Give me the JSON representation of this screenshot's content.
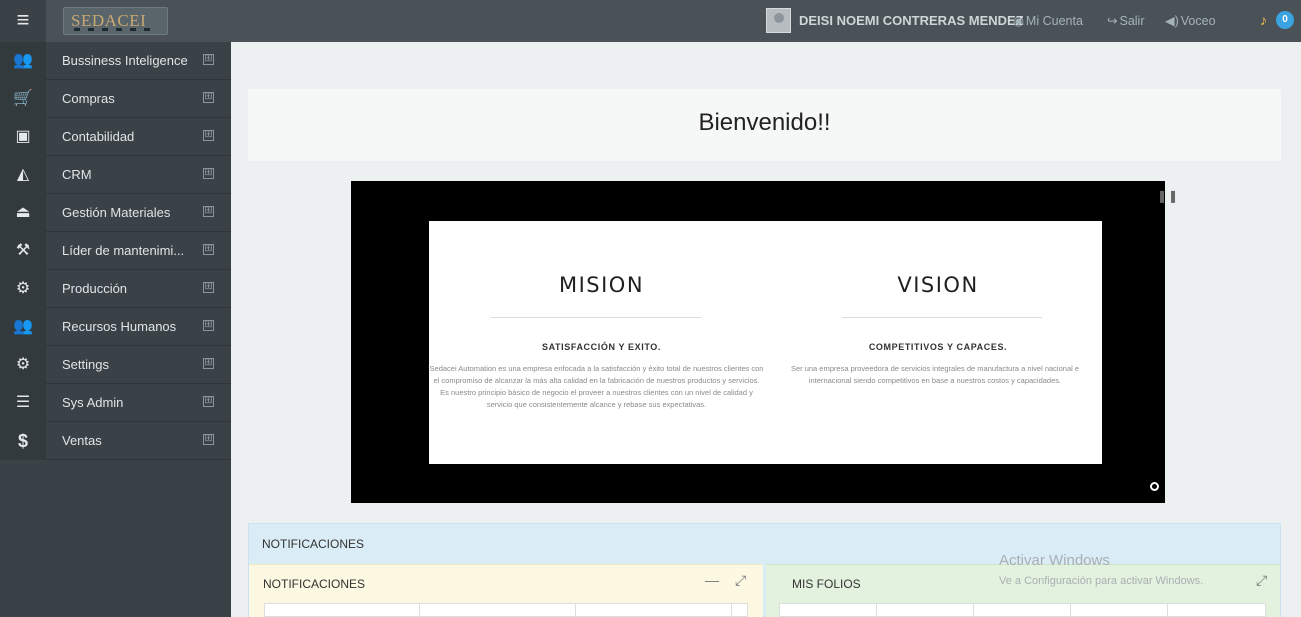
{
  "header": {
    "menu_icon": "hamburger-menu-icon",
    "logo_text": "SEDACEI",
    "user_name": "DEISI NOEMI CONTRERAS MENDEZ",
    "links": {
      "account": "Mi Cuenta",
      "logout": "Salir",
      "voice": "Voceo"
    },
    "notification_count": "0"
  },
  "sidebar": {
    "items": [
      {
        "label": "Bussiness Inteligence",
        "icon": "users-icon"
      },
      {
        "label": "Compras",
        "icon": "cart-icon"
      },
      {
        "label": "Contabilidad",
        "icon": "money-icon"
      },
      {
        "label": "CRM",
        "icon": "area-chart-icon"
      },
      {
        "label": "Gestión Materiales",
        "icon": "inbox-icon"
      },
      {
        "label": "Líder de mantenimi...",
        "icon": "wrench-icon"
      },
      {
        "label": "Producción",
        "icon": "gear-icon"
      },
      {
        "label": "Recursos Humanos",
        "icon": "users-icon"
      },
      {
        "label": "Settings",
        "icon": "gears-icon"
      },
      {
        "label": "Sys Admin",
        "icon": "server-icon"
      },
      {
        "label": "Ventas",
        "icon": "dollar-icon"
      }
    ],
    "expand_symbol": "⊞"
  },
  "main": {
    "welcome": "Bienvenido!!",
    "slide": {
      "mission": {
        "title": "MISION",
        "subtitle": "SATISFACCIÓN Y EXITO.",
        "body": "Sedacei Automation es una empresa enfocada a la satisfacción y éxito total de nuestros clientes con el compromiso de alcanzar la más alta calidad en la fabricación de nuestros productos y servicios. Es nuestro principio básico de negocio el proveer a nuestros clientes con un nivel de calidad y servicio que consistentemente alcance y rebase sus expectativas."
      },
      "vision": {
        "title": "VISION",
        "subtitle": "COMPETITIVOS Y CAPACES.",
        "body": "Ser una empresa proveedora de servicios integrales de manufactura a nivel nacional e internacional siendo competitivos en base a nuestros costos y capacidades."
      }
    },
    "notifications": {
      "section_title": "NOTIFICACIONES",
      "left_panel_title": "NOTIFICACIONES",
      "right_panel_title": "MIS FOLIOS",
      "minimize_symbol": "—",
      "expand_symbol": "⤢"
    }
  },
  "watermark": {
    "line1": "Activar Windows",
    "line2": "Ve a Configuración para activar Windows."
  },
  "colors": {
    "topbar": "#4a5257",
    "sidebar": "#3b4247",
    "badge": "#3ba3e0",
    "notif_panel": "#daecf5",
    "panel_left": "#fcf8e1",
    "panel_right": "#e3f2df"
  }
}
